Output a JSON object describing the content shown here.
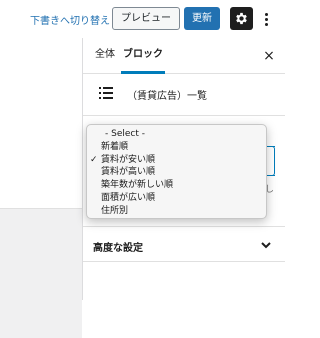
{
  "toolbar": {
    "draft_switch_label": "下書きへ切り替え",
    "preview_label": "プレビュー",
    "update_label": "更新",
    "settings_icon": "gear-icon",
    "more_icon": "more-vertical-icon"
  },
  "sidebar": {
    "tabs": [
      {
        "label": "全体",
        "active": false
      },
      {
        "label": "ブロック",
        "active": true
      }
    ],
    "close_icon": "close-icon",
    "close_glyph": "×",
    "block": {
      "icon": "list-icon",
      "title": "（賃貸広告）一覧"
    },
    "help_snippet": "し",
    "advanced_settings_label": "高度な設定"
  },
  "dropdown": {
    "selected": "賃料が安い順",
    "options": [
      {
        "label": "- Select -",
        "selected": false
      },
      {
        "label": "新着順",
        "selected": false
      },
      {
        "label": "賃料が安い順",
        "selected": true
      },
      {
        "label": "賃料が高い順",
        "selected": false
      },
      {
        "label": "築年数が新しい順",
        "selected": false
      },
      {
        "label": "面積が広い順",
        "selected": false
      },
      {
        "label": "住所別",
        "selected": false
      }
    ],
    "check_glyph": "✓"
  },
  "colors": {
    "accent": "#2271b1",
    "tab_indicator": "#007cba",
    "settings_button_bg": "#1e1e1e"
  }
}
